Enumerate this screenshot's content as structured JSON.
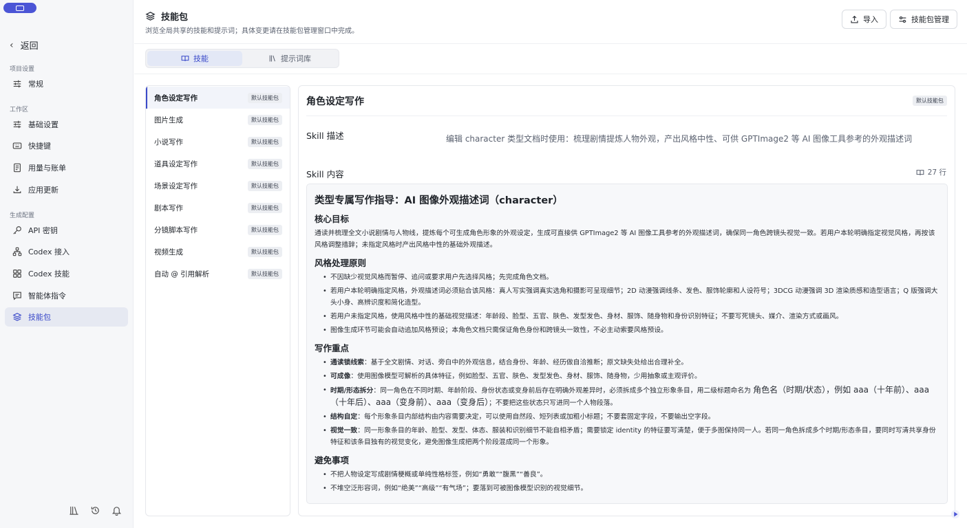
{
  "sidebar": {
    "back_label": "返回",
    "sections": {
      "project": "项目设置",
      "workspace": "工作区",
      "gen": "生成配置"
    },
    "items": [
      {
        "label": "常规",
        "icon": "sliders-icon"
      },
      {
        "label": "基础设置",
        "icon": "sliders-icon"
      },
      {
        "label": "快捷键",
        "icon": "keyboard-icon"
      },
      {
        "label": "用量与账单",
        "icon": "document-icon"
      },
      {
        "label": "应用更新",
        "icon": "download-icon"
      },
      {
        "label": "API 密钥",
        "icon": "key-icon"
      },
      {
        "label": "Codex 接入",
        "icon": "network-icon"
      },
      {
        "label": "Codex 技能",
        "icon": "puzzle-icon"
      },
      {
        "label": "智能体指令",
        "icon": "chat-icon"
      },
      {
        "label": "技能包",
        "icon": "layers-icon"
      }
    ],
    "active_item": "技能包"
  },
  "header": {
    "title": "技能包",
    "subtitle": "浏览全局共享的技能和提示词；具体变更请在技能包管理窗口中完成。",
    "import_label": "导入",
    "manage_label": "技能包管理"
  },
  "tabs": [
    {
      "label": "技能",
      "active": true
    },
    {
      "label": "提示词库",
      "active": false
    }
  ],
  "skills": [
    {
      "name": "角色设定写作",
      "badge": "默认技能包"
    },
    {
      "name": "图片生成",
      "badge": "默认技能包"
    },
    {
      "name": "小说写作",
      "badge": "默认技能包"
    },
    {
      "name": "道具设定写作",
      "badge": "默认技能包"
    },
    {
      "name": "场景设定写作",
      "badge": "默认技能包"
    },
    {
      "name": "剧本写作",
      "badge": "默认技能包"
    },
    {
      "name": "分镜脚本写作",
      "badge": "默认技能包"
    },
    {
      "name": "视频生成",
      "badge": "默认技能包"
    },
    {
      "name": "自动 @ 引用解析",
      "badge": "默认技能包"
    }
  ],
  "detail": {
    "title": "角色设定写作",
    "badge": "默认技能包",
    "desc_label": "Skill 描述",
    "desc_value": "编辑 character 类型文档时使用：梳理剧情提炼人物外观，产出风格中性、可供 GPTImage2 等 AI 图像工具参考的外观描述词",
    "content_label": "Skill 内容",
    "line_count": "27 行",
    "content": {
      "h1": "类型专属写作指导：AI 图像外观描述词（character）",
      "h_goal": "核心目标",
      "goal_text": "通读并梳理全文小说剧情与人物线，提炼每个可生成角色形象的外观设定，生成可直接供 GPTImage2 等 AI 图像工具参考的外观描述词，确保同一角色跨镜头视觉一致。若用户本轮明确指定视觉风格，再按该风格调整措辞；未指定风格时产出风格中性的基础外观描述。",
      "h_style": "风格处理原则",
      "style_items": [
        "不因缺少视觉风格而暂停、追问或要求用户先选择风格；先完成角色文档。",
        "若用户本轮明确指定风格，外观描述词必须贴合该风格：真人写实强调真实选角和摄影可呈现细节；2D 动漫强调线条、发色、服饰轮廓和人设符号；3DCG 动漫强调 3D 渲染质感和造型语言；Q 版强调大头小身、高辨识度和简化造型。",
        "若用户未指定风格，使用风格中性的基础视觉描述：年龄段、脸型、五官、肤色、发型发色、身材、服饰、随身物和身份识别特征；不要写死镜头、媒介、渲染方式或画风。",
        "图像生成环节可能会自动追加风格预设；本角色文档只需保证角色身份和跨镜头一致性，不必主动索要风格预设。"
      ],
      "h_focus": "写作重点",
      "focus_items": [
        {
          "b": "通读锁线索",
          "t": "：基于全文剧情、对话、旁白中的外观信息，结合身份、年龄、经历做自洽推断；原文缺失处给出合理补全。"
        },
        {
          "b": "可成像",
          "t": "：使用图像模型可解析的具体特征，例如脸型、五官、肤色、发型发色、身材、服饰、随身物，少用抽象或主观评价。"
        },
        {
          "b": "时期/形态拆分",
          "t": "：同一角色在不同时期、年龄阶段、身份状态或变身前后存在明确外观差异时，必须拆成多个独立形象条目，用二级标题命名为 ",
          "big": "角色名（时期/状态），例如 aaa（十年前）、aaa（十年后）、aaa（变身前）、aaa（变身后）",
          "t2": "；不要把这些状态只写进同一个人物段落。"
        },
        {
          "b": "结构自定",
          "t": "：每个形象条目内部结构由内容需要决定，可以使用自然段、短列表或加粗小标题；不要套固定字段，不要输出空字段。"
        },
        {
          "b": "视觉一致",
          "t": "：同一形象条目的年龄、脸型、发型、体态、服装和识别细节不能自相矛盾；需要锁定 identity 的特征要写清楚，便于多图保持同一人。若同一角色拆成多个时期/形态条目，要同时写清共享身份特征和该条目独有的视觉变化，避免图像生成把两个阶段混成同一个形象。"
        }
      ],
      "h_avoid": "避免事项",
      "avoid_items": [
        "不把人物设定写成剧情梗概或单纯性格标签，例如“勇敢”“腹黑”“善良”。",
        "不堆空泛形容词，例如“绝美”“高级”“有气场”；要落到可被图像模型识别的视觉细节。"
      ]
    }
  }
}
